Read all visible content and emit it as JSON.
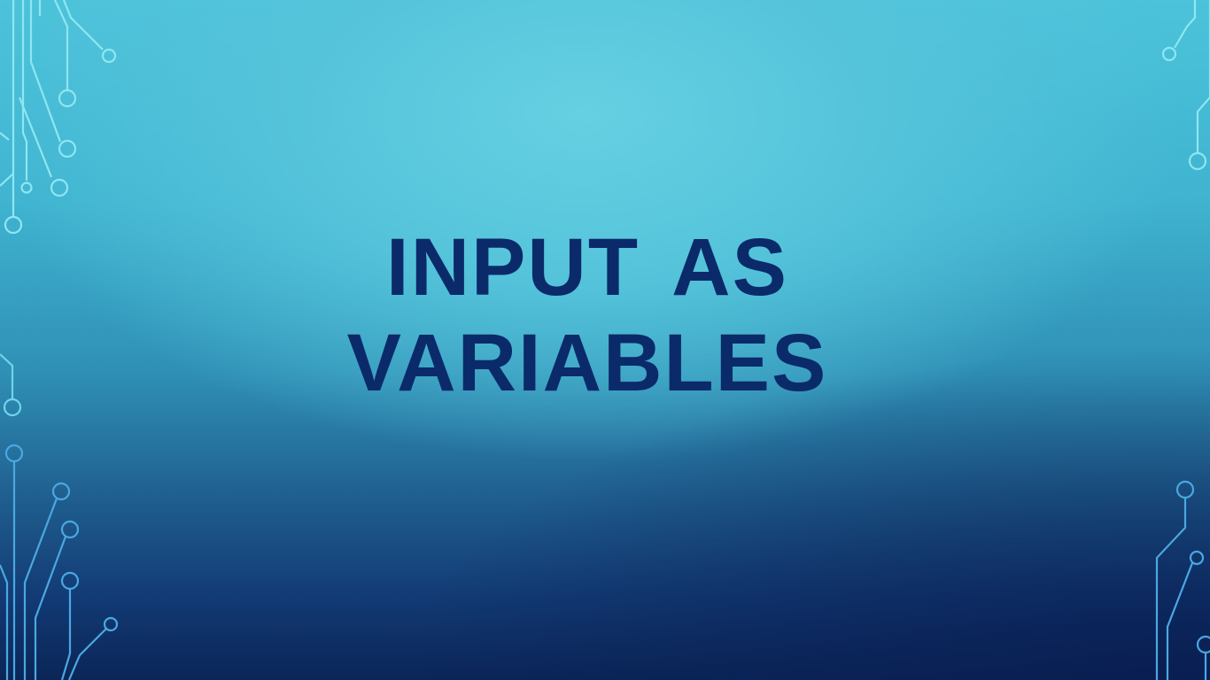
{
  "slide": {
    "title_line1": "INPUT  AS",
    "title_line2": "VARIABLES"
  },
  "colors": {
    "title_text": "#0b2a6a",
    "circuit_light": "#8ee6f2",
    "circuit_dark": "#4aa8e0",
    "background_top": "#4cc3da",
    "background_bottom": "#0b2557"
  },
  "decorations": {
    "top_left": "circuit-lines-icon",
    "top_right": "circuit-lines-icon",
    "bottom_left": "circuit-lines-icon",
    "bottom_right": "circuit-lines-icon"
  }
}
